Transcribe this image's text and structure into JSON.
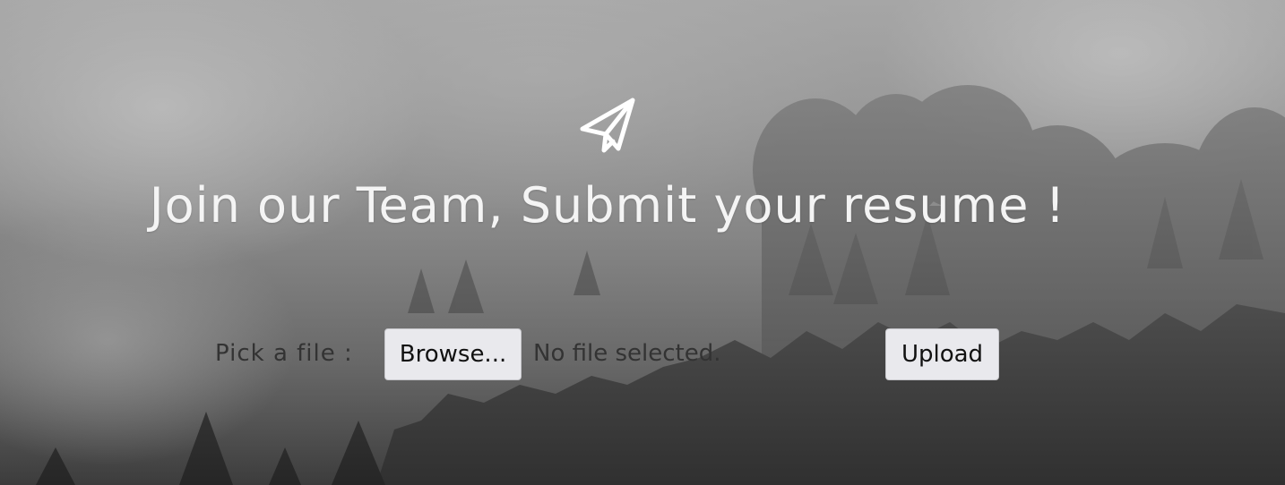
{
  "hero": {
    "icon": "paper-plane-icon",
    "title": "Join our Team, Submit your resume !"
  },
  "upload_form": {
    "label": "Pick a file :",
    "browse_label": "Browse...",
    "file_status": "No file selected.",
    "upload_label": "Upload"
  },
  "colors": {
    "title_text": "#f4f4f4",
    "button_bg": "#e9e9ed",
    "label_text": "#333333"
  }
}
